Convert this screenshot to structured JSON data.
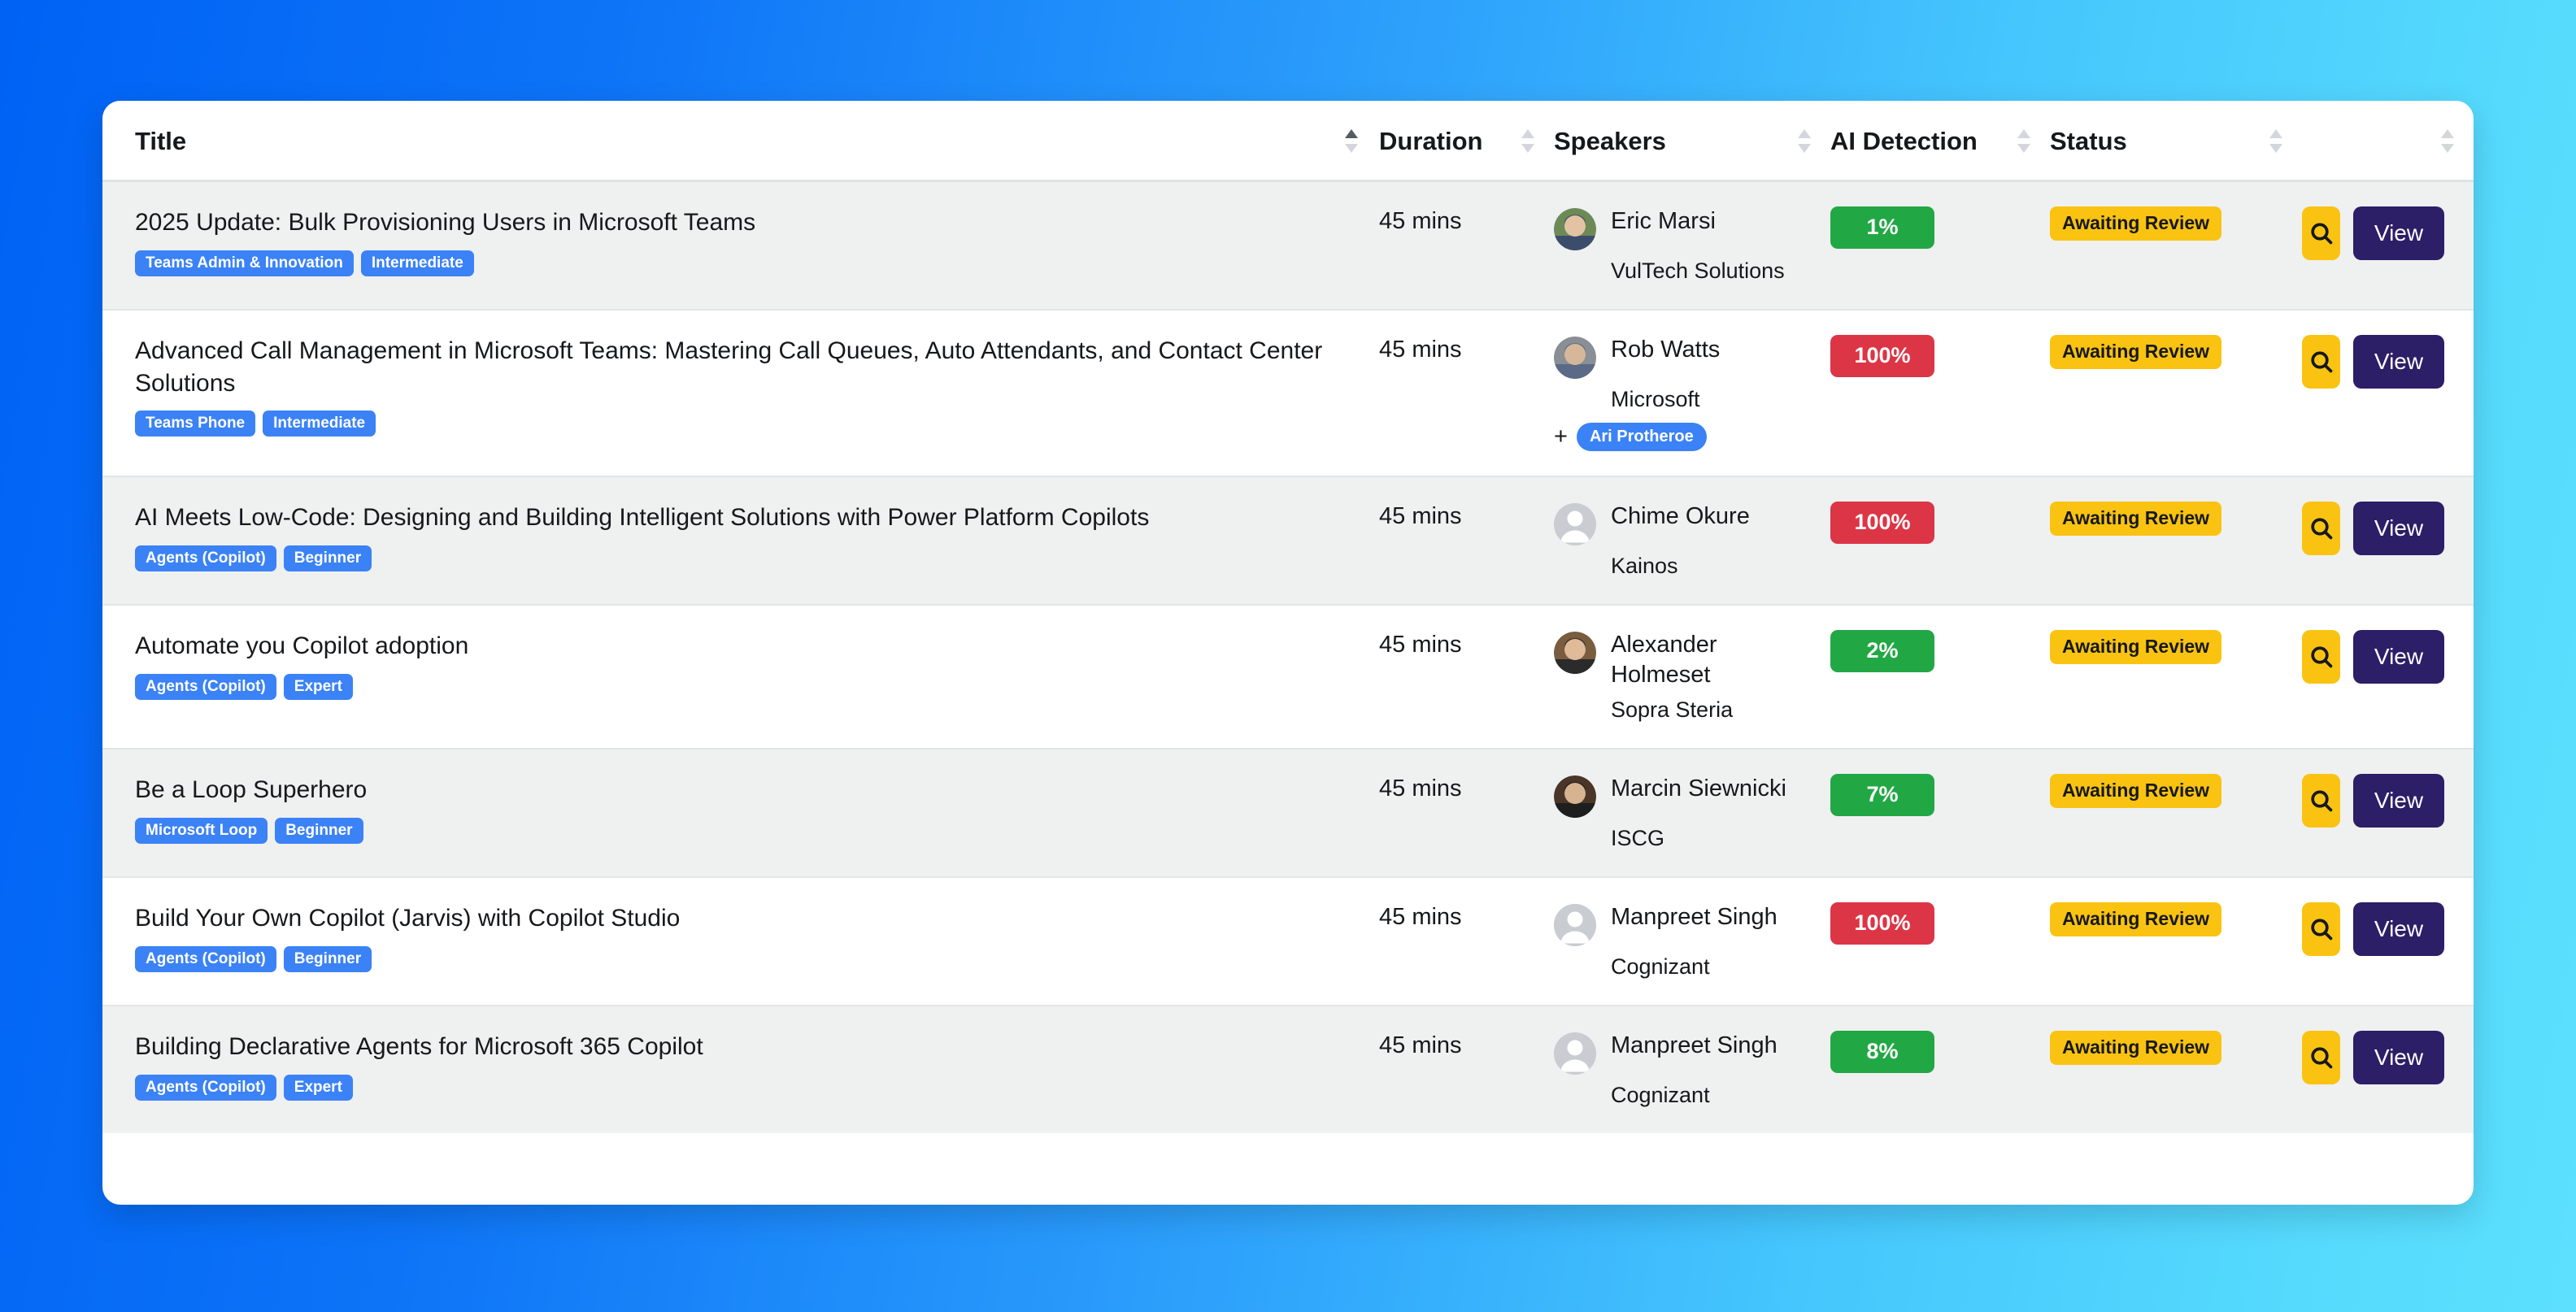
{
  "table": {
    "columns": [
      {
        "label": "Title",
        "sortable": true,
        "sort_state": "asc"
      },
      {
        "label": "Duration",
        "sortable": true,
        "sort_state": "none"
      },
      {
        "label": "Speakers",
        "sortable": true,
        "sort_state": "none"
      },
      {
        "label": "AI Detection",
        "sortable": true,
        "sort_state": "none"
      },
      {
        "label": "Status",
        "sortable": true,
        "sort_state": "none"
      },
      {
        "label": "",
        "sortable": true,
        "sort_state": "none"
      }
    ],
    "rows": [
      {
        "title": "2025 Update: Bulk Provisioning Users in Microsoft Teams",
        "tags": [
          "Teams Admin & Innovation",
          "Intermediate"
        ],
        "duration": "45 mins",
        "speaker_name": "Eric Marsi",
        "speaker_org": "VulTech Solutions",
        "avatar_type": "photo",
        "extra_speakers": [],
        "ai_detection": "1%",
        "ai_level": "low",
        "status": "Awaiting Review",
        "search_label": "",
        "view_label": "View"
      },
      {
        "title": "Advanced Call Management in Microsoft Teams: Mastering Call Queues, Auto Attendants, and Contact Center Solutions",
        "tags": [
          "Teams Phone",
          "Intermediate"
        ],
        "duration": "45 mins",
        "speaker_name": "Rob Watts",
        "speaker_org": "Microsoft",
        "avatar_type": "photo",
        "extra_speakers": [
          "Ari Protheroe"
        ],
        "ai_detection": "100%",
        "ai_level": "high",
        "status": "Awaiting Review",
        "search_label": "",
        "view_label": "View"
      },
      {
        "title": "AI Meets Low-Code: Designing and Building Intelligent Solutions with Power Platform Copilots",
        "tags": [
          "Agents (Copilot)",
          "Beginner"
        ],
        "duration": "45 mins",
        "speaker_name": "Chime Okure",
        "speaker_org": "Kainos",
        "avatar_type": "placeholder",
        "extra_speakers": [],
        "ai_detection": "100%",
        "ai_level": "high",
        "status": "Awaiting Review",
        "search_label": "",
        "view_label": "View"
      },
      {
        "title": "Automate you Copilot adoption",
        "tags": [
          "Agents (Copilot)",
          "Expert"
        ],
        "duration": "45 mins",
        "speaker_name": "Alexander Holmeset",
        "speaker_org": "Sopra Steria",
        "avatar_type": "photo",
        "extra_speakers": [],
        "ai_detection": "2%",
        "ai_level": "low",
        "status": "Awaiting Review",
        "search_label": "",
        "view_label": "View"
      },
      {
        "title": "Be a Loop Superhero",
        "tags": [
          "Microsoft Loop",
          "Beginner"
        ],
        "duration": "45 mins",
        "speaker_name": "Marcin Siewnicki",
        "speaker_org": "ISCG",
        "avatar_type": "photo",
        "extra_speakers": [],
        "ai_detection": "7%",
        "ai_level": "low",
        "status": "Awaiting Review",
        "search_label": "",
        "view_label": "View"
      },
      {
        "title": "Build Your Own Copilot (Jarvis) with Copilot Studio",
        "tags": [
          "Agents (Copilot)",
          "Beginner"
        ],
        "duration": "45 mins",
        "speaker_name": "Manpreet Singh",
        "speaker_org": "Cognizant",
        "avatar_type": "placeholder",
        "extra_speakers": [],
        "ai_detection": "100%",
        "ai_level": "high",
        "status": "Awaiting Review",
        "search_label": "",
        "view_label": "View"
      },
      {
        "title": "Building Declarative Agents for Microsoft 365 Copilot",
        "tags": [
          "Agents (Copilot)",
          "Expert"
        ],
        "duration": "45 mins",
        "speaker_name": "Manpreet Singh",
        "speaker_org": "Cognizant",
        "avatar_type": "placeholder",
        "extra_speakers": [],
        "ai_detection": "8%",
        "ai_level": "low",
        "status": "Awaiting Review",
        "search_label": "",
        "view_label": "View"
      }
    ]
  },
  "colors": {
    "tag_blue": "#3b82f6",
    "ai_low_green": "#22a745",
    "ai_high_red": "#dc3546",
    "status_amber": "#fac311",
    "view_indigo": "#2c1e67",
    "row_alt": "#eff0f0"
  }
}
